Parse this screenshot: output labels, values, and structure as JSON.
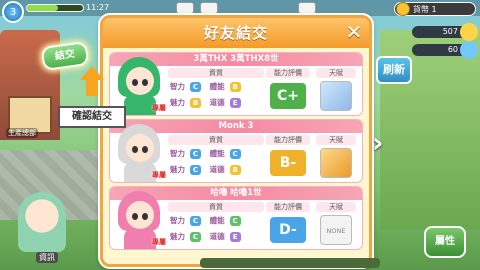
{
  "hud": {
    "level": "3",
    "exp_progress": 0.55,
    "time": "11:27",
    "coins": "貨幣 1"
  },
  "side_stats": [
    {
      "value": "507",
      "color": "#ffd34a"
    },
    {
      "value": "60",
      "color": "#72c8ff"
    }
  ],
  "left_labels": {
    "house": "生產總部",
    "bottom_name": "資訊"
  },
  "dialog": {
    "title": "好友結交",
    "close_label": "✕"
  },
  "header_labels": {
    "stats": "資質",
    "eval": "能力評價",
    "talent": "天賦"
  },
  "stat_labels": {
    "wisdom": "智力",
    "skill": "體能",
    "charm": "魅力",
    "speed": "道德"
  },
  "cards": [
    {
      "name": "3萬THX 3萬THX8世",
      "hair_color": "#35b66a",
      "rank": "專屬",
      "stats": {
        "wisdom": "C",
        "skill": "B",
        "charm": "B",
        "speed": "E"
      },
      "eval": "C+",
      "eval_color": "#4fb04a",
      "talent": "icon"
    },
    {
      "name": "Monk 3",
      "hair_color": "#d9d9d9",
      "rank": "專屬",
      "stats": {
        "wisdom": "C",
        "skill": "C",
        "charm": "C",
        "speed": "B"
      },
      "eval": "B-",
      "eval_color": "#f0b12a",
      "talent": "icon"
    },
    {
      "name": "哈嚕 哈嚕1世",
      "hair_color": "#f07fb0",
      "rank": "專屬",
      "stats": {
        "wisdom": "C",
        "skill": "C",
        "charm": "C",
        "speed": "E"
      },
      "eval": "D-",
      "eval_color": "#4aa4e8",
      "talent": "NONE"
    }
  ],
  "buttons": {
    "confirm": "結交",
    "tooltip": "確認結交",
    "refresh": "刷新",
    "attribute": "屬性"
  }
}
